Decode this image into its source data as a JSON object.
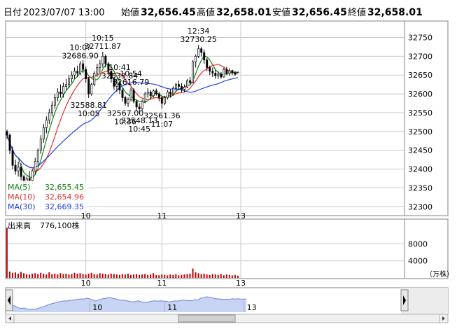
{
  "header": {
    "prefix": "日付",
    "datetime": "2023/07/07 13:00",
    "open_label": "始値",
    "open_value": "32,656.45",
    "high_label": "高値",
    "high_value": "32,658.01",
    "low_label": "安値",
    "low_value": "32,656.45",
    "close_label": "終値",
    "close_value": "32,658.01"
  },
  "colors": {
    "up": "#000000",
    "down": "#000000",
    "high_value": "#e02020",
    "low_value": "#109010",
    "ma5": "#108010",
    "ma10": "#e03030",
    "ma30": "#2040e0",
    "volume": "#c00000",
    "grid": "#c8c8c8",
    "navigator_fill": "#c8d4f4",
    "navigator_line": "#6a86d8"
  },
  "chart_data": {
    "type": "candlestick",
    "price_axis": {
      "ticks": [
        32300,
        32350,
        32400,
        32450,
        32500,
        32550,
        32600,
        32650,
        32700,
        32750
      ],
      "ylim": [
        32280,
        32790
      ]
    },
    "x_tick_labels": [
      {
        "label": "10",
        "bar": 28
      },
      {
        "label": "11",
        "bar": 55
      },
      {
        "label": "13",
        "bar": 83
      }
    ],
    "bars": [
      {
        "o": 32500,
        "h": 32505,
        "l": 32480,
        "c": 32490
      },
      {
        "o": 32490,
        "h": 32495,
        "l": 32440,
        "c": 32450
      },
      {
        "o": 32450,
        "h": 32460,
        "l": 32400,
        "c": 32410
      },
      {
        "o": 32410,
        "h": 32425,
        "l": 32385,
        "c": 32395
      },
      {
        "o": 32395,
        "h": 32420,
        "l": 32380,
        "c": 32405
      },
      {
        "o": 32405,
        "h": 32415,
        "l": 32370,
        "c": 32380
      },
      {
        "o": 32380,
        "h": 32385,
        "l": 32360,
        "c": 32365
      },
      {
        "o": 32365,
        "h": 32380,
        "l": 32355,
        "c": 32375
      },
      {
        "o": 32375,
        "h": 32395,
        "l": 32360,
        "c": 32370
      },
      {
        "o": 32370,
        "h": 32400,
        "l": 32360,
        "c": 32395
      },
      {
        "o": 32395,
        "h": 32430,
        "l": 32385,
        "c": 32420
      },
      {
        "o": 32420,
        "h": 32455,
        "l": 32410,
        "c": 32450
      },
      {
        "o": 32450,
        "h": 32490,
        "l": 32440,
        "c": 32480
      },
      {
        "o": 32480,
        "h": 32520,
        "l": 32470,
        "c": 32510
      },
      {
        "o": 32510,
        "h": 32540,
        "l": 32495,
        "c": 32530
      },
      {
        "o": 32530,
        "h": 32560,
        "l": 32520,
        "c": 32550
      },
      {
        "o": 32550,
        "h": 32580,
        "l": 32540,
        "c": 32570
      },
      {
        "o": 32570,
        "h": 32600,
        "l": 32560,
        "c": 32590
      },
      {
        "o": 32590,
        "h": 32615,
        "l": 32580,
        "c": 32605
      },
      {
        "o": 32605,
        "h": 32625,
        "l": 32590,
        "c": 32600
      },
      {
        "o": 32600,
        "h": 32630,
        "l": 32590,
        "c": 32620
      },
      {
        "o": 32620,
        "h": 32640,
        "l": 32610,
        "c": 32625
      },
      {
        "o": 32625,
        "h": 32650,
        "l": 32615,
        "c": 32640
      },
      {
        "o": 32640,
        "h": 32660,
        "l": 32630,
        "c": 32650
      },
      {
        "o": 32650,
        "h": 32670,
        "l": 32640,
        "c": 32660
      },
      {
        "o": 32660,
        "h": 32675,
        "l": 32645,
        "c": 32655
      },
      {
        "o": 32655,
        "h": 32687,
        "l": 32650,
        "c": 32680
      },
      {
        "o": 32680,
        "h": 32690,
        "l": 32655,
        "c": 32665
      },
      {
        "o": 32665,
        "h": 32672,
        "l": 32630,
        "c": 32640
      },
      {
        "o": 32640,
        "h": 32645,
        "l": 32589,
        "c": 32600
      },
      {
        "o": 32600,
        "h": 32630,
        "l": 32595,
        "c": 32625
      },
      {
        "o": 32625,
        "h": 32660,
        "l": 32620,
        "c": 32655
      },
      {
        "o": 32655,
        "h": 32680,
        "l": 32645,
        "c": 32670
      },
      {
        "o": 32670,
        "h": 32690,
        "l": 32655,
        "c": 32680
      },
      {
        "o": 32680,
        "h": 32712,
        "l": 32670,
        "c": 32700
      },
      {
        "o": 32700,
        "h": 32705,
        "l": 32670,
        "c": 32680
      },
      {
        "o": 32680,
        "h": 32685,
        "l": 32650,
        "c": 32660
      },
      {
        "o": 32660,
        "h": 32665,
        "l": 32630,
        "c": 32640
      },
      {
        "o": 32640,
        "h": 32645,
        "l": 32610,
        "c": 32620
      },
      {
        "o": 32620,
        "h": 32640,
        "l": 32605,
        "c": 32630
      },
      {
        "o": 32630,
        "h": 32634,
        "l": 32600,
        "c": 32610
      },
      {
        "o": 32610,
        "h": 32615,
        "l": 32580,
        "c": 32590
      },
      {
        "o": 32590,
        "h": 32595,
        "l": 32568,
        "c": 32575
      },
      {
        "o": 32575,
        "h": 32590,
        "l": 32565,
        "c": 32585
      },
      {
        "o": 32585,
        "h": 32617,
        "l": 32580,
        "c": 32610
      },
      {
        "o": 32610,
        "h": 32615,
        "l": 32575,
        "c": 32580
      },
      {
        "o": 32580,
        "h": 32585,
        "l": 32555,
        "c": 32565
      },
      {
        "o": 32565,
        "h": 32575,
        "l": 32548,
        "c": 32560
      },
      {
        "o": 32560,
        "h": 32585,
        "l": 32556,
        "c": 32580
      },
      {
        "o": 32580,
        "h": 32605,
        "l": 32575,
        "c": 32600
      },
      {
        "o": 32600,
        "h": 32615,
        "l": 32590,
        "c": 32605
      },
      {
        "o": 32605,
        "h": 32610,
        "l": 32585,
        "c": 32595
      },
      {
        "o": 32595,
        "h": 32612,
        "l": 32590,
        "c": 32608
      },
      {
        "o": 32608,
        "h": 32614,
        "l": 32595,
        "c": 32600
      },
      {
        "o": 32600,
        "h": 32605,
        "l": 32580,
        "c": 32590
      },
      {
        "o": 32590,
        "h": 32595,
        "l": 32561,
        "c": 32575
      },
      {
        "o": 32575,
        "h": 32595,
        "l": 32570,
        "c": 32590
      },
      {
        "o": 32590,
        "h": 32610,
        "l": 32585,
        "c": 32605
      },
      {
        "o": 32605,
        "h": 32612,
        "l": 32590,
        "c": 32600
      },
      {
        "o": 32600,
        "h": 32620,
        "l": 32595,
        "c": 32615
      },
      {
        "o": 32615,
        "h": 32630,
        "l": 32605,
        "c": 32625
      },
      {
        "o": 32625,
        "h": 32635,
        "l": 32610,
        "c": 32620
      },
      {
        "o": 32620,
        "h": 32628,
        "l": 32605,
        "c": 32612
      },
      {
        "o": 32612,
        "h": 32625,
        "l": 32605,
        "c": 32618
      },
      {
        "o": 32618,
        "h": 32640,
        "l": 32615,
        "c": 32635
      },
      {
        "o": 32635,
        "h": 32645,
        "l": 32625,
        "c": 32630
      },
      {
        "o": 32630,
        "h": 32690,
        "l": 32628,
        "c": 32685
      },
      {
        "o": 32685,
        "h": 32705,
        "l": 32670,
        "c": 32700
      },
      {
        "o": 32700,
        "h": 32730,
        "l": 32695,
        "c": 32720
      },
      {
        "o": 32720,
        "h": 32725,
        "l": 32700,
        "c": 32710
      },
      {
        "o": 32710,
        "h": 32718,
        "l": 32680,
        "c": 32690
      },
      {
        "o": 32690,
        "h": 32695,
        "l": 32660,
        "c": 32670
      },
      {
        "o": 32670,
        "h": 32675,
        "l": 32650,
        "c": 32660
      },
      {
        "o": 32660,
        "h": 32670,
        "l": 32645,
        "c": 32655
      },
      {
        "o": 32655,
        "h": 32665,
        "l": 32640,
        "c": 32648
      },
      {
        "o": 32648,
        "h": 32660,
        "l": 32640,
        "c": 32652
      },
      {
        "o": 32652,
        "h": 32658,
        "l": 32640,
        "c": 32645
      },
      {
        "o": 32645,
        "h": 32670,
        "l": 32643,
        "c": 32665
      },
      {
        "o": 32665,
        "h": 32672,
        "l": 32650,
        "c": 32655
      },
      {
        "o": 32655,
        "h": 32668,
        "l": 32648,
        "c": 32662
      },
      {
        "o": 32662,
        "h": 32664,
        "l": 32650,
        "c": 32656
      },
      {
        "o": 32656,
        "h": 32660,
        "l": 32648,
        "c": 32652
      },
      {
        "o": 32656,
        "h": 32658,
        "l": 32656,
        "c": 32658
      }
    ],
    "annotations": [
      {
        "lines": [
          "10:15",
          "32711.87"
        ],
        "bar": 34,
        "type": "high"
      },
      {
        "lines": [
          "10:0?",
          "32686.90"
        ],
        "bar": 26,
        "type": "high"
      },
      {
        "lines": [
          "32588.81",
          "10:05"
        ],
        "bar": 29,
        "type": "low"
      },
      {
        "lines": [
          "10:41",
          "32633.84"
        ],
        "bar": 40,
        "type": "high"
      },
      {
        "lines": [
          "10:54",
          "32616.79"
        ],
        "bar": 44,
        "type": "high"
      },
      {
        "lines": [
          "32567.00",
          "10:36"
        ],
        "bar": 42,
        "type": "low"
      },
      {
        "lines": [
          "32548.13",
          "10:45"
        ],
        "bar": 47,
        "type": "low"
      },
      {
        "lines": [
          "32561.36",
          "11:07"
        ],
        "bar": 55,
        "type": "low"
      },
      {
        "lines": [
          "12:34",
          "32730.25"
        ],
        "bar": 68,
        "type": "high"
      }
    ],
    "moving_averages": [
      {
        "label": "MA(5)",
        "value": "32,655.45",
        "period": 5,
        "color_key": "ma5"
      },
      {
        "label": "MA(10)",
        "value": "32,654.96",
        "period": 10,
        "color_key": "ma10"
      },
      {
        "label": "MA(30)",
        "value": "32,669.35",
        "period": 30,
        "color_key": "ma30"
      }
    ],
    "volume": {
      "label": "出来高",
      "value": "776,100株",
      "unit": "（万株）",
      "ticks": [
        4000,
        8000
      ],
      "ylim": [
        0,
        13000
      ],
      "values": [
        11800,
        1500,
        1200,
        1300,
        1000,
        1400,
        1100,
        900,
        800,
        1000,
        1100,
        900,
        1200,
        1000,
        800,
        1300,
        900,
        1000,
        800,
        1100,
        900,
        1000,
        800,
        900,
        1200,
        1000,
        1100,
        900,
        800,
        1000,
        1200,
        900,
        800,
        1100,
        1000,
        900,
        800,
        1000,
        900,
        800,
        700,
        900,
        800,
        1000,
        700,
        800,
        900,
        700,
        800,
        900,
        700,
        800,
        1100,
        700,
        600,
        800,
        700,
        600,
        800,
        700,
        900,
        600,
        700,
        800,
        900,
        1000,
        2200,
        1300,
        1100,
        900,
        1000,
        800,
        700,
        900,
        800,
        700,
        900,
        600,
        800,
        700,
        600,
        700,
        500
      ]
    },
    "navigator": {
      "x_tick_labels": [
        {
          "label": "10",
          "frac": 0.33
        },
        {
          "label": "11",
          "frac": 0.65
        },
        {
          "label": "13",
          "frac": 0.99
        }
      ]
    }
  }
}
